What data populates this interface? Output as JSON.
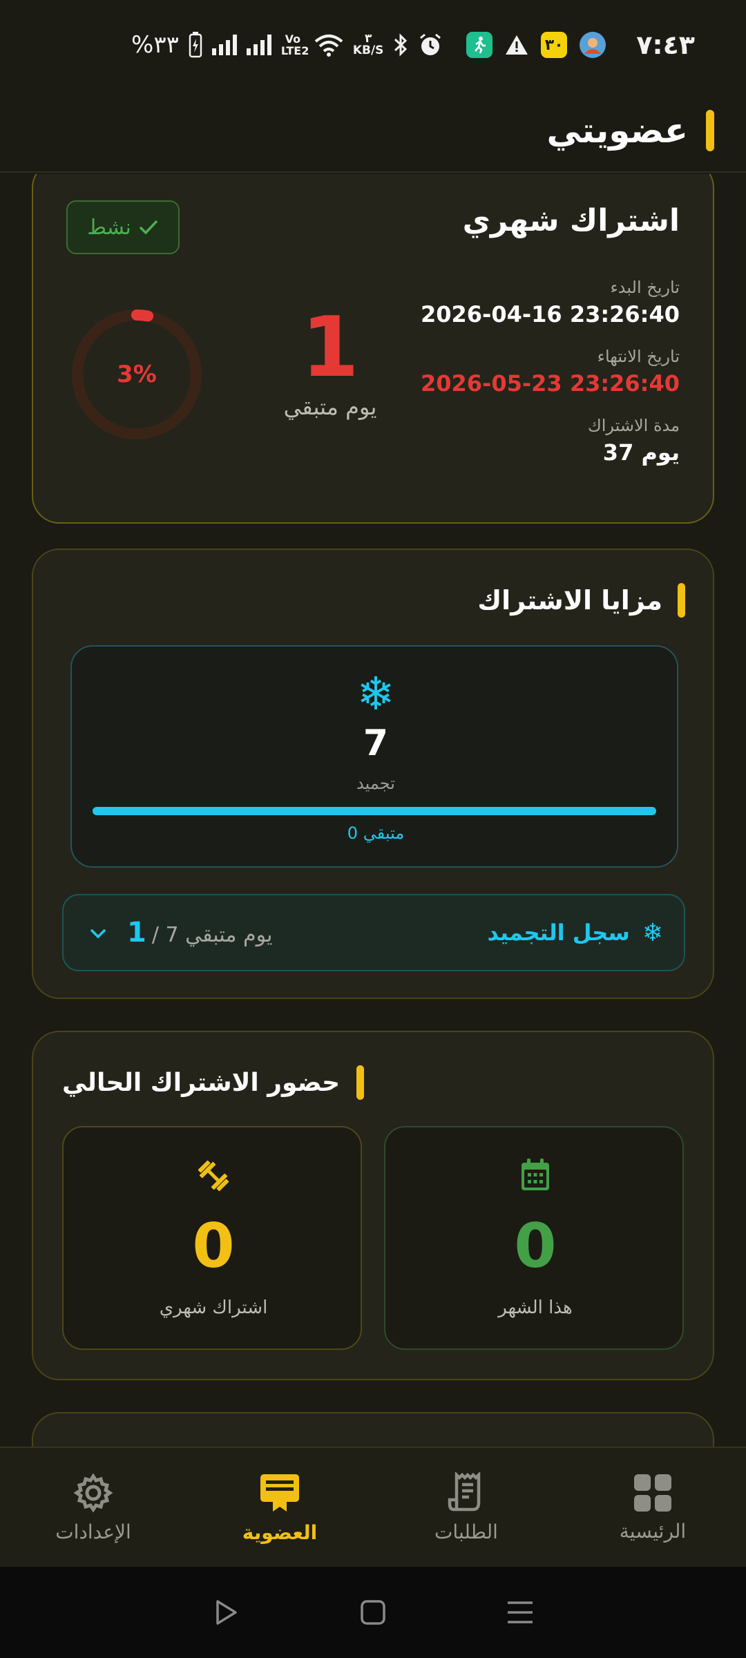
{
  "status_bar": {
    "time": "٧:٤٣",
    "battery": "%٣٣",
    "net_speed_value": "٣",
    "net_speed_unit": "KB/S",
    "network_type": "Vo LTE2",
    "yellow_app_label": "٣٠"
  },
  "header": {
    "title": "عضويتي"
  },
  "subscription": {
    "title": "اشتراك شهري",
    "status": "نشط",
    "start_label": "تاريخ البدء",
    "start_value": "2026-04-16 23:26:40",
    "end_label": "تاريخ الانتهاء",
    "end_value": "2026-05-23 23:26:40",
    "duration_label": "مدة الاشتراك",
    "duration_value": "37 يوم",
    "remaining_days": "1",
    "remaining_label": "يوم متبقي",
    "progress_text": "3%",
    "progress_fraction": 0.03,
    "colors": {
      "active": "#4caf50",
      "danger": "#e53935",
      "accent": "#f2c014"
    }
  },
  "benefits": {
    "title": "مزايا الاشتراك",
    "freeze_count": "7",
    "freeze_label": "تجميد",
    "freeze_used_fraction": 1.0,
    "freeze_remaining_text": "متبقي 0",
    "log_title": "سجل التجميد",
    "log_used": "1",
    "log_total_text": "/ 7 يوم متبقي",
    "color": "#1ec8ee"
  },
  "attendance": {
    "title": "حضور الاشتراك الحالي",
    "this_month_value": "0",
    "this_month_label": "هذا الشهر",
    "subscription_value": "0",
    "subscription_label": "اشتراك شهري",
    "colors": {
      "month": "#43a047",
      "subscription": "#f2c014"
    }
  },
  "bottom_nav": {
    "items": [
      {
        "label": "الإعدادات",
        "icon": "gear-icon"
      },
      {
        "label": "العضوية",
        "icon": "membership-icon",
        "active": true
      },
      {
        "label": "الطلبات",
        "icon": "receipt-icon"
      },
      {
        "label": "الرئيسية",
        "icon": "grid-icon"
      }
    ]
  },
  "system_nav": {
    "icons": [
      "play-icon",
      "square-icon",
      "menu-icon"
    ]
  }
}
